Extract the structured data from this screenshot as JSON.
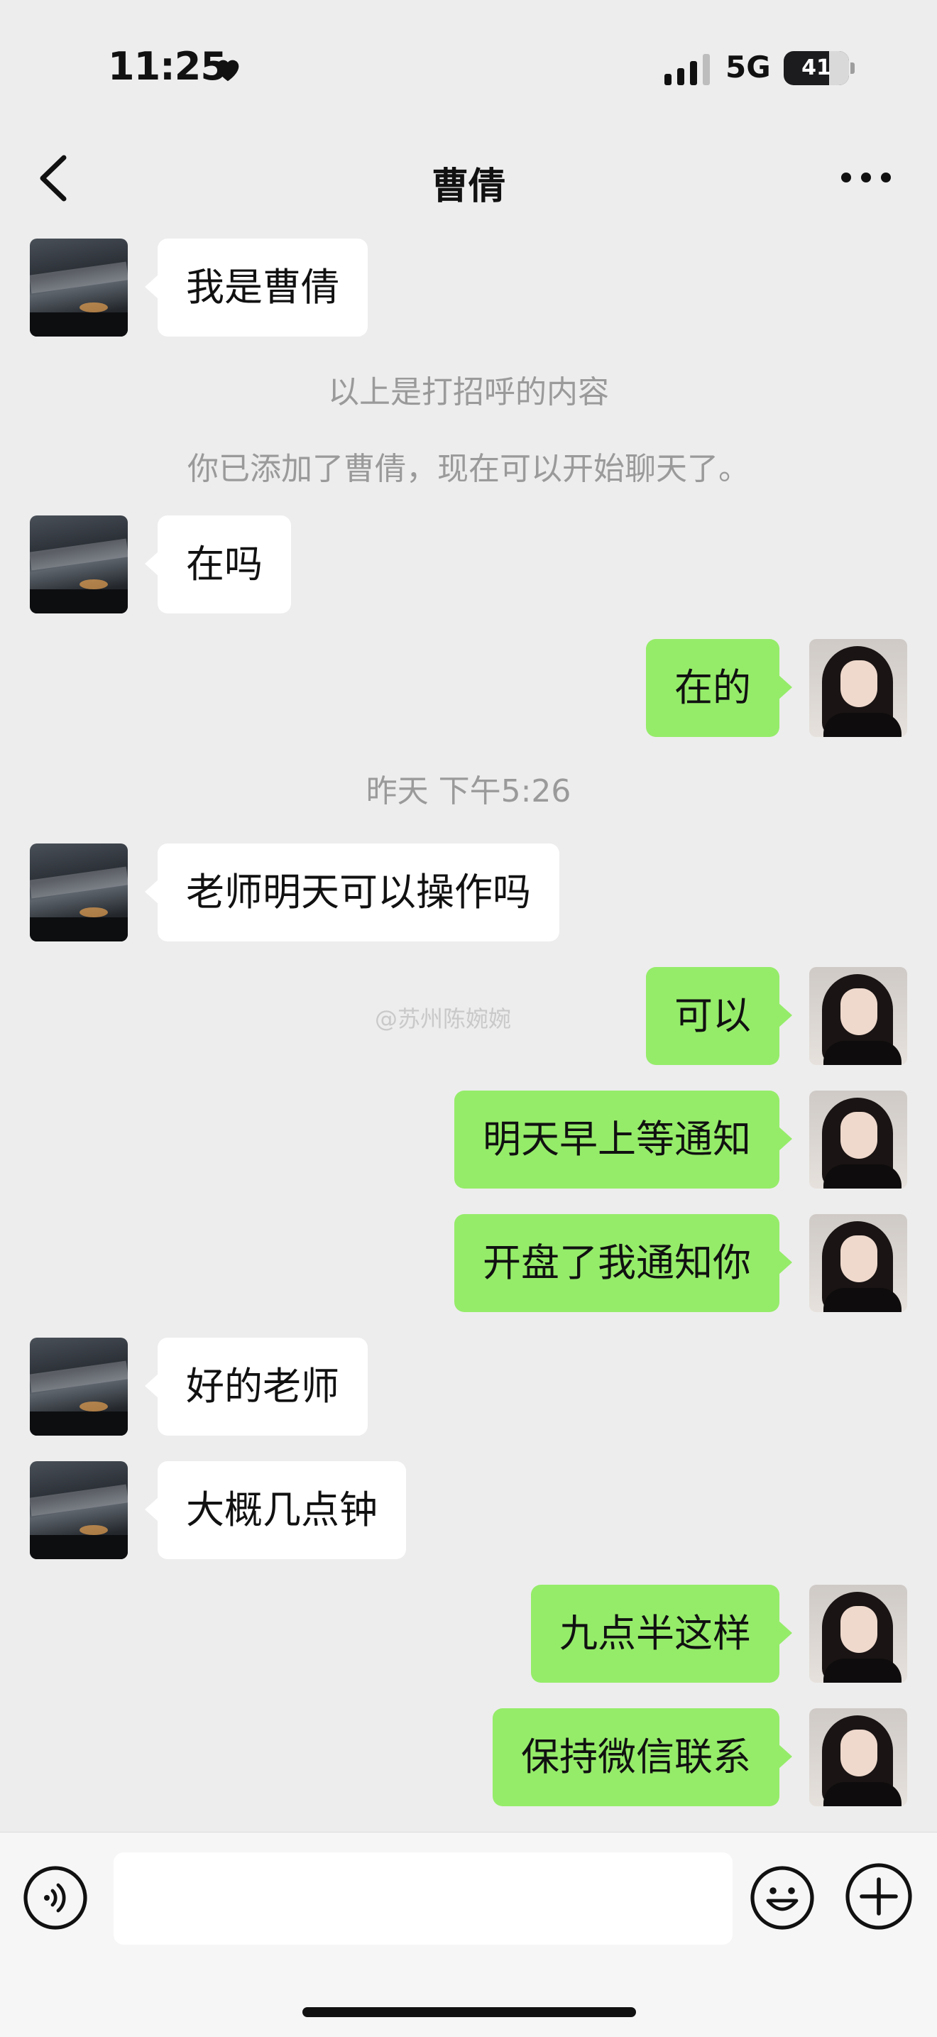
{
  "status": {
    "time": "11:25",
    "network": "5G",
    "battery": "41"
  },
  "header": {
    "title": "曹倩",
    "back_icon": "chevron-left-icon",
    "more_icon": "more-dots-icon"
  },
  "messages": [
    {
      "side": "in",
      "text": "我是曹倩"
    },
    {
      "type": "system",
      "text": "以上是打招呼的内容"
    },
    {
      "type": "system",
      "text": "你已添加了曹倩，现在可以开始聊天了。"
    },
    {
      "side": "in",
      "text": "在吗"
    },
    {
      "side": "out",
      "text": "在的"
    },
    {
      "type": "time",
      "text": "昨天 下午5:26"
    },
    {
      "side": "in",
      "text": "老师明天可以操作吗"
    },
    {
      "side": "out",
      "text": "可以"
    },
    {
      "side": "out",
      "text": "明天早上等通知"
    },
    {
      "side": "out",
      "text": "开盘了我通知你"
    },
    {
      "side": "in",
      "text": "好的老师"
    },
    {
      "side": "in",
      "text": "大概几点钟"
    },
    {
      "side": "out",
      "text": "九点半这样"
    },
    {
      "side": "out",
      "text": "保持微信联系"
    }
  ],
  "watermark": "@苏州陈婉婉",
  "input_bar": {
    "value": "",
    "voice_icon": "voice-icon",
    "emoji_icon": "emoji-icon",
    "plus_icon": "plus-icon"
  }
}
